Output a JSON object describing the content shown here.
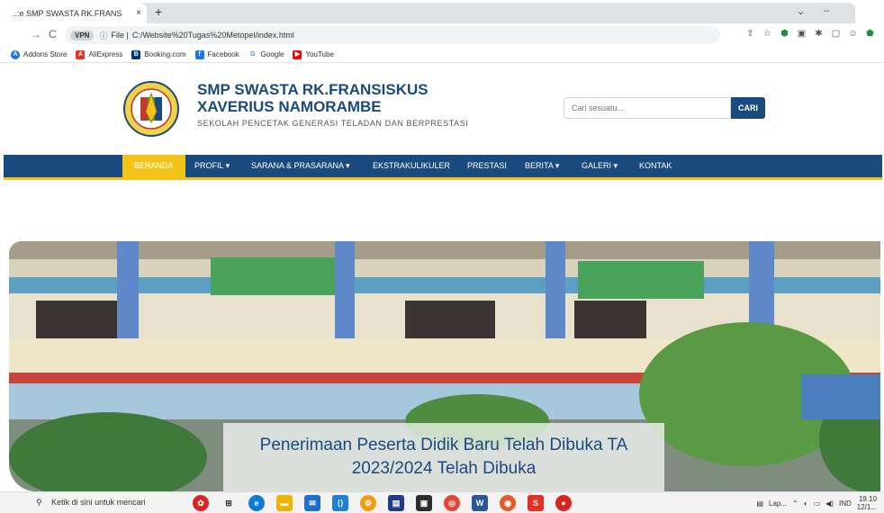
{
  "browser": {
    "tab_title": "..:e SMP SWASTA RK.FRANS",
    "tab_close": "×",
    "new_tab": "+",
    "vpn_label": "VPN",
    "file_label": "File |",
    "url": "C:/Website%20Tugas%20Metopel/index.html"
  },
  "bookmarks": [
    {
      "label": "Addons Store",
      "color": "#1a73e8",
      "icon": "A"
    },
    {
      "label": "AliExpress",
      "color": "#e43225",
      "icon": "A"
    },
    {
      "label": "Booking.com",
      "color": "#003580",
      "icon": "B"
    },
    {
      "label": "Facebook",
      "color": "#1877f2",
      "icon": "f"
    },
    {
      "label": "Google",
      "color": "#4285f4",
      "icon": "G"
    },
    {
      "label": "YouTube",
      "color": "#ff0000",
      "icon": "▶"
    }
  ],
  "site": {
    "name": "SMP SWASTA RK.FRANSISKUS XAVERIUS NAMORAMBE",
    "tagline": "SEKOLAH PENCETAK GENERASI TELADAN DAN BERPRESTASI",
    "search_placeholder": "Cari sesuatu...",
    "search_button": "CARI",
    "primary_color": "#1a4a7e",
    "accent_color": "#f2c318"
  },
  "nav": [
    {
      "label": "BERANDA",
      "active": true
    },
    {
      "label": "PROFIL ▾",
      "active": false
    },
    {
      "label": "SARANA & PRASARANA ▾",
      "active": false
    },
    {
      "label": "EKSTRAKULIKULER",
      "active": false
    },
    {
      "label": "PRESTASI",
      "active": false
    },
    {
      "label": "BERITA ▾",
      "active": false
    },
    {
      "label": "GALERI ▾",
      "active": false
    },
    {
      "label": "KONTAK",
      "active": false
    }
  ],
  "hero": {
    "caption": "Penerimaan Peserta Didik Baru Telah Dibuka TA 2023/2024 Telah Dibuka"
  },
  "taskbar": {
    "search": "Ketik di sini untuk mencari",
    "running_label": "Lap...",
    "language": "IND",
    "time": "19.10",
    "date": "12/1..."
  }
}
